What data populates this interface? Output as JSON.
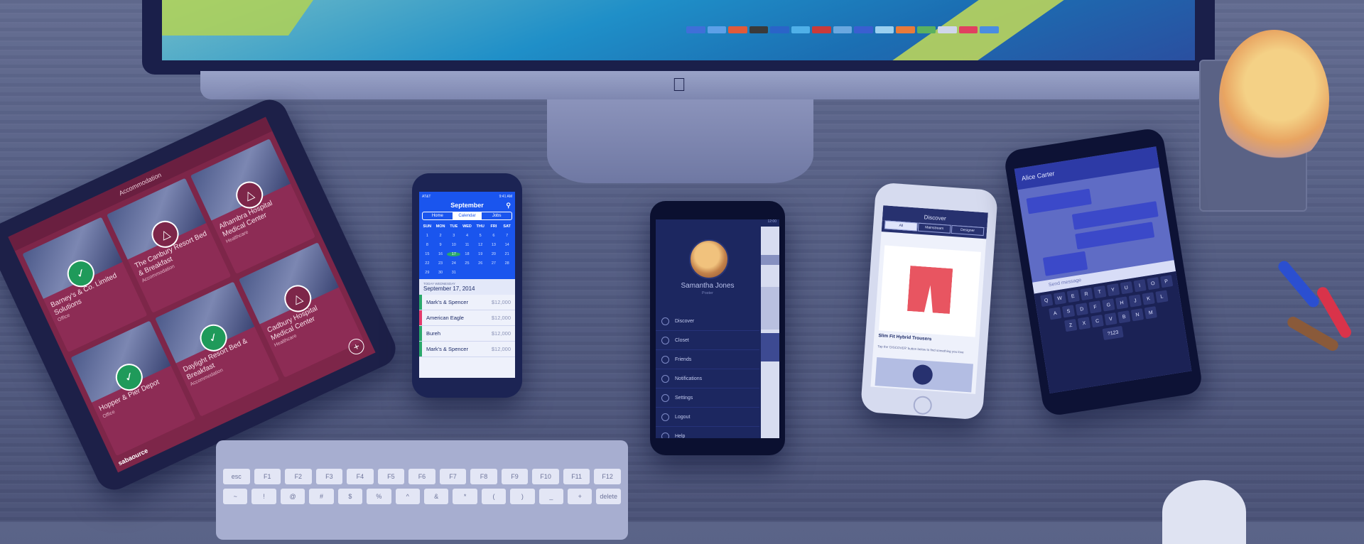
{
  "ipad": {
    "header": "Accommodation",
    "logo": "sabaource",
    "cards": [
      {
        "title": "Barney's & Co. Limited Solutions",
        "sub": "Office",
        "badge": "check"
      },
      {
        "title": "The Canbury Resort Bed & Breakfast",
        "sub": "Accommodation",
        "badge": "triangle"
      },
      {
        "title": "Alhambra Hospital Medical Center",
        "sub": "Healthcare",
        "badge": "triangle"
      },
      {
        "title": "Hopper & Pier Depot",
        "sub": "Office",
        "badge": "check"
      },
      {
        "title": "Daylight Resort Bed & Breakfast",
        "sub": "Accommodation",
        "badge": "check"
      },
      {
        "title": "Cadbury Hospital Medical Center",
        "sub": "Healthcare",
        "badge": "triangle"
      }
    ]
  },
  "calendar_phone": {
    "status": "AT&T",
    "time": "9:41 AM",
    "month": "September",
    "tabs": [
      "Home",
      "Calendar",
      "Jobs"
    ],
    "days": [
      "SUN",
      "MON",
      "TUE",
      "WED",
      "THU",
      "FRI",
      "SAT"
    ],
    "dates": [
      "1",
      "2",
      "3",
      "4",
      "5",
      "6",
      "7",
      "8",
      "9",
      "10",
      "11",
      "12",
      "13",
      "14",
      "15",
      "16",
      "17",
      "18",
      "19",
      "20",
      "21",
      "22",
      "23",
      "24",
      "25",
      "26",
      "27",
      "28",
      "29",
      "30",
      "31"
    ],
    "selected_date": "September 17, 2014",
    "date_caption": "TODAY WEDNESDAY",
    "entries": [
      {
        "name": "Mark's & Spencer",
        "amount": "$12,000",
        "color": "#2aa86b"
      },
      {
        "name": "American Eagle",
        "amount": "$12,000",
        "color": "#e23a6b"
      },
      {
        "name": "Bureh",
        "amount": "$12,000",
        "color": "#2aa86b"
      },
      {
        "name": "Mark's & Spencer",
        "amount": "$12,000",
        "color": "#2aa86b"
      }
    ]
  },
  "menu_phone": {
    "time": "12:00",
    "name": "Samantha Jones",
    "role": "Poster",
    "items": [
      "Discover",
      "Closet",
      "Friends",
      "Notifications",
      "Settings",
      "Logout",
      "Help"
    ],
    "side_text": [
      "Discov",
      "Slim"
    ]
  },
  "shop_phone": {
    "status": "Carrier",
    "time": "12:00 AM",
    "title": "Discover",
    "tabs": [
      "All",
      "Mainstream",
      "Designer"
    ],
    "product": "Slim Fit Hybrid Trousers",
    "note": "Tap the 'DISCOVER' button below to find something you love"
  },
  "chat_phone": {
    "time": "12:06",
    "contact": "Alice Carter",
    "input_placeholder": "Send message",
    "keys_row1": [
      "Q",
      "W",
      "E",
      "R",
      "T",
      "Y",
      "U",
      "I",
      "O",
      "P"
    ],
    "keys_row2": [
      "A",
      "S",
      "D",
      "F",
      "G",
      "H",
      "J",
      "K",
      "L"
    ],
    "keys_row3": [
      "Z",
      "X",
      "C",
      "V",
      "B",
      "N",
      "M"
    ],
    "bottom": "?123"
  },
  "keyboard": {
    "row1": [
      "esc",
      "F1",
      "F2",
      "F3",
      "F4",
      "F5",
      "F6",
      "F7",
      "F8",
      "F9",
      "F10",
      "F11",
      "F12"
    ],
    "row2": [
      "~",
      "!",
      "@",
      "#",
      "$",
      "%",
      "^",
      "&",
      "*",
      "(",
      ")",
      "_",
      "+",
      "delete"
    ]
  },
  "colors": {
    "tint": "#4b5378",
    "ipad_accent": "#7d2649",
    "calendar_blue": "#1a55ee",
    "menu_bg": "#1c2760",
    "chat_header": "#2d3aa6",
    "shorts": "#e85561"
  }
}
